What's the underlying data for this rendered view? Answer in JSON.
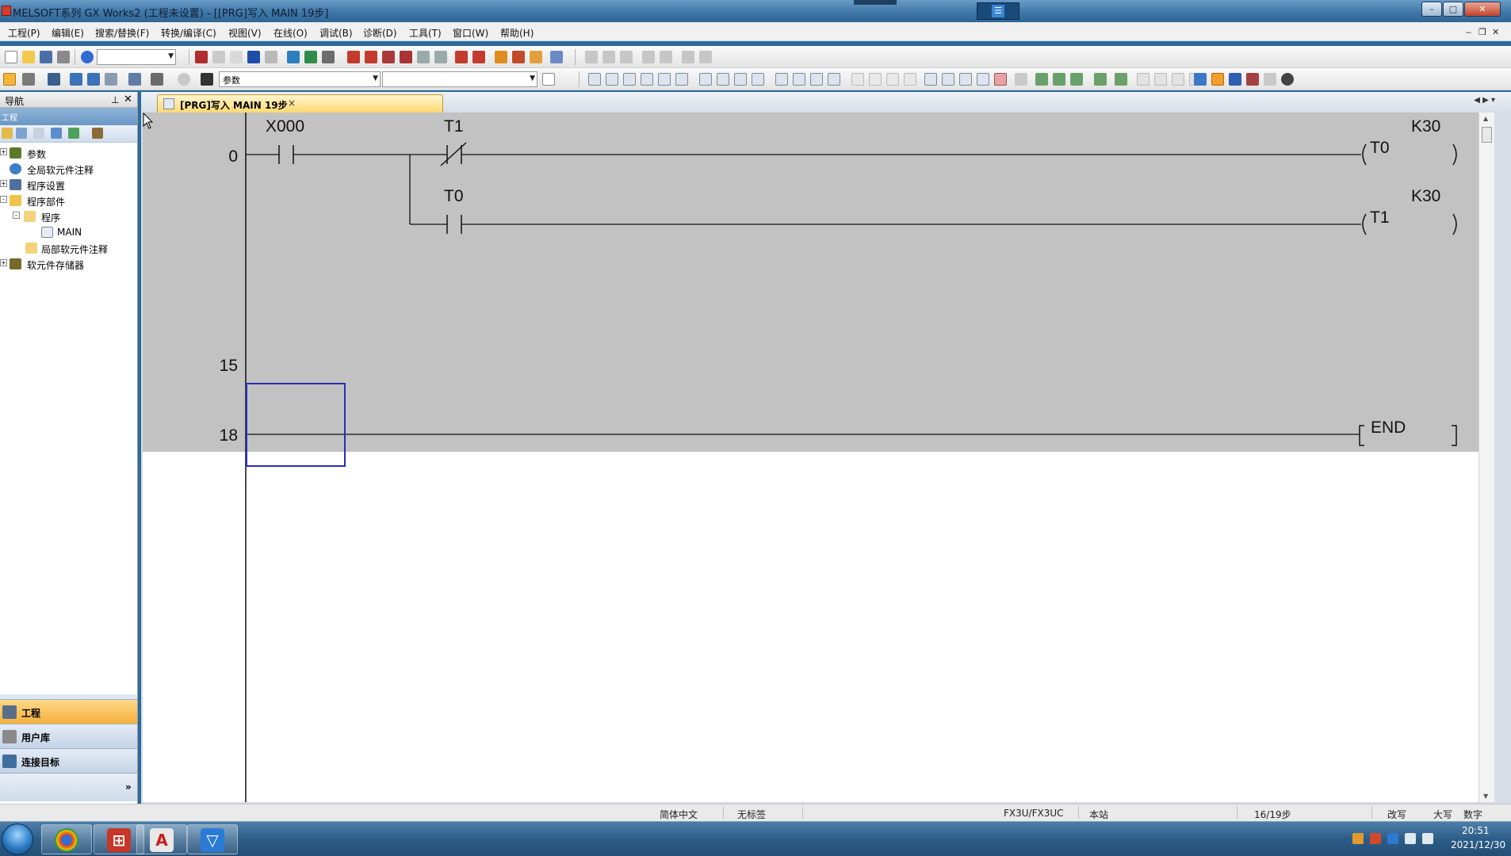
{
  "window": {
    "title": "MELSOFT系列 GX Works2 (工程未设置) - [[PRG]写入 MAIN 19步]"
  },
  "menu": {
    "items": [
      "工程(P)",
      "编辑(E)",
      "搜索/替换(F)",
      "转换/编译(C)",
      "视图(V)",
      "在线(O)",
      "调试(B)",
      "诊断(D)",
      "工具(T)",
      "窗口(W)",
      "帮助(H)"
    ]
  },
  "toolbar": {
    "combo_small": "",
    "combo_param": "参数",
    "combo_empty": ""
  },
  "nav": {
    "title": "导航",
    "pin_icon": "pin-icon",
    "subheader": "工程",
    "tree": [
      {
        "label": "参数",
        "expander": "+"
      },
      {
        "label": "全局软元件注释",
        "expander": ""
      },
      {
        "label": "程序设置",
        "expander": "+"
      },
      {
        "label": "程序部件",
        "expander": "-"
      },
      {
        "label": "程序",
        "expander": "-"
      },
      {
        "label": "MAIN",
        "expander": ""
      },
      {
        "label": "局部软元件注释",
        "expander": ""
      },
      {
        "label": "软元件存储器",
        "expander": "+"
      }
    ],
    "bottom_buttons": [
      "工程",
      "用户库",
      "连接目标"
    ],
    "more_glyph": "»"
  },
  "doc_tab": {
    "label": "[PRG]写入 MAIN 19步",
    "close": "×"
  },
  "ladder": {
    "rungs": [
      {
        "step": "0"
      },
      {
        "step": "15"
      },
      {
        "step": "18"
      }
    ],
    "labels": {
      "x000": "X000",
      "t1_contact": "T1",
      "t0_contact": "T0",
      "k30_a": "K30",
      "k30_b": "K30",
      "coil_t0": "T0",
      "coil_t1": "T1",
      "end": "END"
    }
  },
  "status": {
    "language": "简体中文",
    "label_status": "无标签",
    "plc_type": "FX3U/FX3UC",
    "station": "本站",
    "steps": "16/19步",
    "mode": "改写",
    "caps": "大写",
    "num": "数字"
  },
  "taskbar": {
    "time": "20:51",
    "date": "2021/12/30"
  },
  "colors": {
    "ladder_selected_block": "#c2c2c2",
    "cursor_border": "#2a2fb3",
    "active_nav_button": "#f6b13a",
    "doc_tab_active": "#ffd971"
  }
}
